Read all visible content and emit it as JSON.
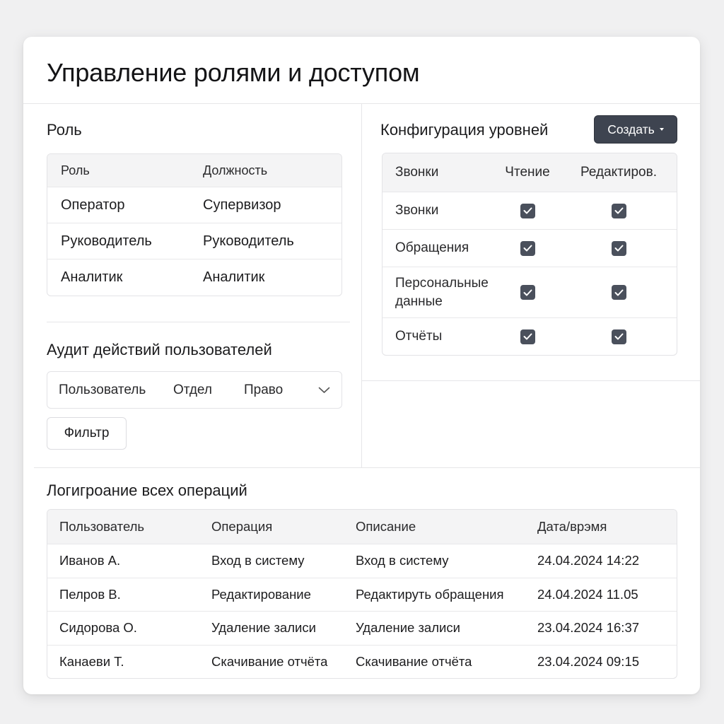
{
  "page": {
    "title": "Управление ролями и доступом"
  },
  "roles": {
    "title": "Роль",
    "headers": [
      "Роль",
      "Должность"
    ],
    "rows": [
      [
        "Оператор",
        "Супервизор"
      ],
      [
        "Руководитель",
        "Руководитель"
      ],
      [
        "Аналитик",
        "Аналитик"
      ]
    ]
  },
  "levels": {
    "title": "Конфигурация уровней",
    "create_label": "Создать",
    "headers": [
      "Звонки",
      "Чтение",
      "Редактиров."
    ],
    "rows": [
      {
        "name": "Звонки",
        "read": true,
        "edit": true
      },
      {
        "name": "Обращения",
        "read": true,
        "edit": true
      },
      {
        "name_line1": "Персональные",
        "name_line2": "данные",
        "read": true,
        "edit": true
      },
      {
        "name": "Отчёты",
        "read": true,
        "edit": true
      }
    ]
  },
  "audit": {
    "title": "Аудит действий пользователей",
    "filters": [
      "Пользователь",
      "Отдел",
      "Право"
    ],
    "filter_button": "Фильтр"
  },
  "log": {
    "title": "Логигроание всех операций",
    "headers": [
      "Пользователь",
      "Операция",
      "Описание",
      "Дата/врэмя"
    ],
    "rows": [
      [
        "Иванов А.",
        "Вход в систему",
        "Вход в систему",
        "24.04.2024 14:22"
      ],
      [
        "Пелров В.",
        "Редактирование",
        "Редактируть обращения",
        "24.04.2024 11.05"
      ],
      [
        "Сидорова О.",
        "Удаление залиси",
        "Удаление залиси",
        "23.04.2024 16:37"
      ],
      [
        "Канаеви Т.",
        "Скачивание отчёта",
        "Скачивание отчёта",
        "23.04.2024 09:15"
      ]
    ]
  },
  "colors": {
    "accent": "#3e4450",
    "checkbox": "#4a505c",
    "header_bg": "#f4f4f5",
    "border": "#e3e3e6"
  },
  "icons": {
    "checkbox": "check-icon",
    "dropdown": "chevron-down-icon",
    "caret": "caret-down-icon"
  }
}
